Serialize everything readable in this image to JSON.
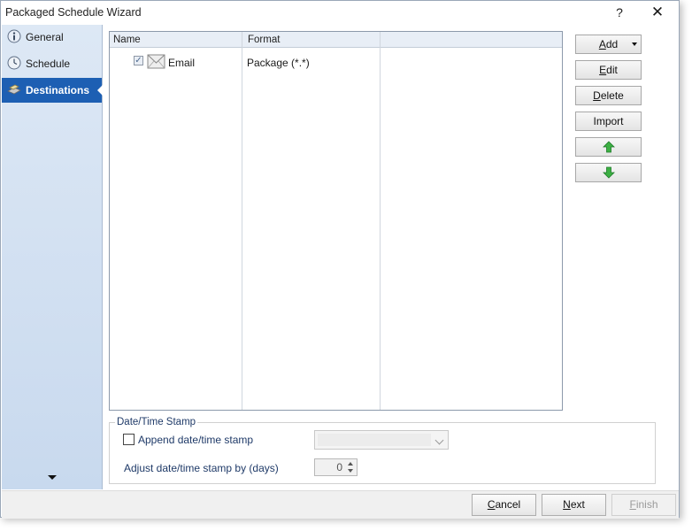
{
  "window": {
    "title": "Packaged Schedule Wizard",
    "help_label": "?",
    "close_label": "✕"
  },
  "sidebar": {
    "items": [
      {
        "label": "General",
        "icon": "info-icon",
        "active": false
      },
      {
        "label": "Schedule",
        "icon": "clock-icon",
        "active": false
      },
      {
        "label": "Destinations",
        "icon": "destination-icon",
        "active": true
      }
    ]
  },
  "grid": {
    "columns": [
      "Name",
      "Format"
    ],
    "rows": [
      {
        "checked": true,
        "icon": "envelope-icon",
        "name": "Email",
        "format": "Package (*.*)"
      }
    ]
  },
  "buttons": {
    "add": {
      "label": "Add",
      "mnemonic": "A",
      "rest": "dd"
    },
    "edit": {
      "label": "Edit",
      "mnemonic": "E",
      "rest": "dit"
    },
    "delete": {
      "label": "Delete",
      "mnemonic": "D",
      "rest": "elete"
    },
    "import": {
      "label": "Import"
    },
    "move_up_icon": "green-arrow-up-icon",
    "move_down_icon": "green-arrow-down-icon"
  },
  "datetime": {
    "group_label": "Date/Time Stamp",
    "append_label": "Append date/time stamp",
    "append_checked": false,
    "format_value": "",
    "adjust_label": "Adjust date/time stamp by (days)",
    "adjust_value": "0"
  },
  "footer": {
    "cancel": {
      "mnemonic": "C",
      "rest": "ancel"
    },
    "next": {
      "mnemonic": "N",
      "rest": "ext"
    },
    "finish": {
      "mnemonic": "F",
      "rest": "inish"
    }
  },
  "colors": {
    "accent": "#1d5fb3",
    "sidebar_top": "#dde8f5",
    "sidebar_bottom": "#c8d9ee",
    "arrow_green": "#3cb043"
  }
}
